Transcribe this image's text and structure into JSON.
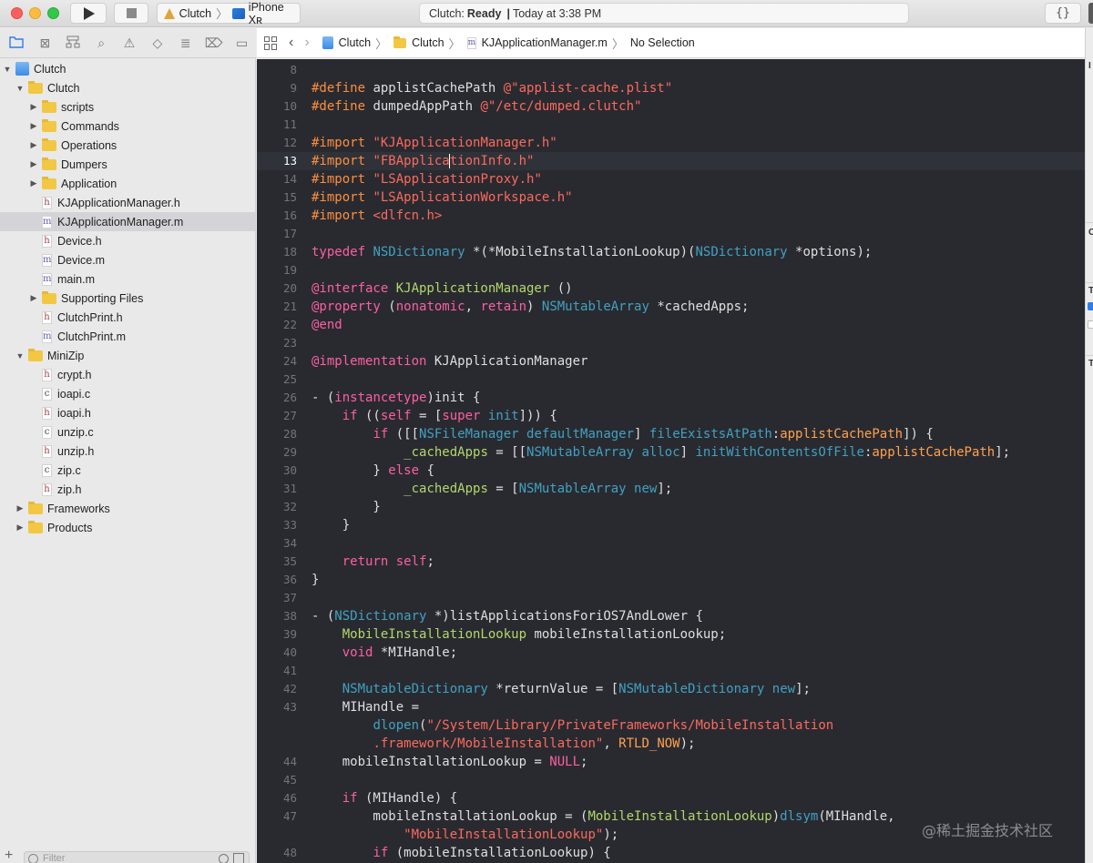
{
  "toolbar": {
    "scheme": {
      "target": "Clutch",
      "device": "iPhone Xʀ"
    },
    "activity": {
      "project": "Clutch:",
      "status": "Ready",
      "separator": "|",
      "time": "Today at 3:38 PM"
    },
    "braces_label": "{}"
  },
  "navigator_tabs": [
    {
      "name": "project-navigator",
      "glyph": "folder",
      "active": true
    },
    {
      "name": "source-control-navigator",
      "glyph": "⊠"
    },
    {
      "name": "symbol-navigator",
      "glyph": "hierarchy"
    },
    {
      "name": "find-navigator",
      "glyph": "⌕"
    },
    {
      "name": "issue-navigator",
      "glyph": "⚠"
    },
    {
      "name": "test-navigator",
      "glyph": "◇"
    },
    {
      "name": "debug-navigator",
      "glyph": "≣"
    },
    {
      "name": "breakpoint-navigator",
      "glyph": "⌦"
    },
    {
      "name": "report-navigator",
      "glyph": "▭"
    }
  ],
  "tree": [
    {
      "label": "Clutch",
      "depth": 0,
      "kind": "project",
      "disclosure": "open"
    },
    {
      "label": "Clutch",
      "depth": 1,
      "kind": "folder",
      "disclosure": "open"
    },
    {
      "label": "scripts",
      "depth": 2,
      "kind": "folder",
      "disclosure": "closed"
    },
    {
      "label": "Commands",
      "depth": 2,
      "kind": "folder",
      "disclosure": "closed"
    },
    {
      "label": "Operations",
      "depth": 2,
      "kind": "folder",
      "disclosure": "closed"
    },
    {
      "label": "Dumpers",
      "depth": 2,
      "kind": "folder",
      "disclosure": "closed"
    },
    {
      "label": "Application",
      "depth": 2,
      "kind": "folder",
      "disclosure": "closed"
    },
    {
      "label": "KJApplicationManager.h",
      "depth": 3,
      "kind": "h"
    },
    {
      "label": "KJApplicationManager.m",
      "depth": 3,
      "kind": "m",
      "selected": true
    },
    {
      "label": "Device.h",
      "depth": 3,
      "kind": "h"
    },
    {
      "label": "Device.m",
      "depth": 3,
      "kind": "m"
    },
    {
      "label": "main.m",
      "depth": 3,
      "kind": "m"
    },
    {
      "label": "Supporting Files",
      "depth": 2,
      "kind": "folder",
      "disclosure": "closed"
    },
    {
      "label": "ClutchPrint.h",
      "depth": 3,
      "kind": "h"
    },
    {
      "label": "ClutchPrint.m",
      "depth": 3,
      "kind": "m"
    },
    {
      "label": "MiniZip",
      "depth": 1,
      "kind": "folder",
      "disclosure": "open"
    },
    {
      "label": "crypt.h",
      "depth": 3,
      "kind": "h"
    },
    {
      "label": "ioapi.c",
      "depth": 3,
      "kind": "c"
    },
    {
      "label": "ioapi.h",
      "depth": 3,
      "kind": "h"
    },
    {
      "label": "unzip.c",
      "depth": 3,
      "kind": "c"
    },
    {
      "label": "unzip.h",
      "depth": 3,
      "kind": "h"
    },
    {
      "label": "zip.c",
      "depth": 3,
      "kind": "c"
    },
    {
      "label": "zip.h",
      "depth": 3,
      "kind": "h"
    },
    {
      "label": "Frameworks",
      "depth": 1,
      "kind": "folder",
      "disclosure": "closed"
    },
    {
      "label": "Products",
      "depth": 1,
      "kind": "folder",
      "disclosure": "closed"
    }
  ],
  "filter": {
    "placeholder": "Filter",
    "add_label": "+"
  },
  "jumpbar": {
    "items": [
      {
        "label": "Clutch",
        "kind": "project"
      },
      {
        "label": "Clutch",
        "kind": "folder"
      },
      {
        "label": "KJApplicationManager.m",
        "kind": "m"
      },
      {
        "label": "No Selection",
        "kind": "none"
      }
    ],
    "separator": "〉"
  },
  "editor": {
    "current_line": 13,
    "lines": [
      {
        "n": "8",
        "tokens": []
      },
      {
        "n": "9",
        "tokens": [
          [
            "k-pre",
            "#define "
          ],
          [
            "k-plain",
            "applistCachePath "
          ],
          [
            "k-str",
            "@\"applist-cache.plist\""
          ]
        ]
      },
      {
        "n": "10",
        "tokens": [
          [
            "k-pre",
            "#define "
          ],
          [
            "k-plain",
            "dumpedAppPath "
          ],
          [
            "k-str",
            "@\"/etc/dumped.clutch\""
          ]
        ]
      },
      {
        "n": "11",
        "tokens": []
      },
      {
        "n": "12",
        "tokens": [
          [
            "k-pre",
            "#import "
          ],
          [
            "k-str",
            "\"KJApplicationManager.h\""
          ]
        ]
      },
      {
        "n": "13",
        "tokens": [
          [
            "k-pre",
            "#import "
          ],
          [
            "k-str",
            "\"FBApplica"
          ],
          [
            "caret",
            ""
          ],
          [
            "k-str",
            "tionInfo.h\""
          ]
        ]
      },
      {
        "n": "14",
        "tokens": [
          [
            "k-pre",
            "#import "
          ],
          [
            "k-str",
            "\"LSApplicationProxy.h\""
          ]
        ]
      },
      {
        "n": "15",
        "tokens": [
          [
            "k-pre",
            "#import "
          ],
          [
            "k-str",
            "\"LSApplicationWorkspace.h\""
          ]
        ]
      },
      {
        "n": "16",
        "tokens": [
          [
            "k-pre",
            "#import "
          ],
          [
            "k-str",
            "<dlfcn.h>"
          ]
        ]
      },
      {
        "n": "17",
        "tokens": []
      },
      {
        "n": "18",
        "tokens": [
          [
            "k-kw",
            "typedef "
          ],
          [
            "k-sys",
            "NSDictionary"
          ],
          [
            "k-plain",
            " *(*MobileInstallationLookup)("
          ],
          [
            "k-sys",
            "NSDictionary"
          ],
          [
            "k-plain",
            " *options);"
          ]
        ]
      },
      {
        "n": "19",
        "tokens": []
      },
      {
        "n": "20",
        "tokens": [
          [
            "k-kw",
            "@interface "
          ],
          [
            "k-decl",
            "KJApplicationManager"
          ],
          [
            "k-plain",
            " ()"
          ]
        ]
      },
      {
        "n": "21",
        "tokens": [
          [
            "k-kw",
            "@property "
          ],
          [
            "k-plain",
            "("
          ],
          [
            "k-kw",
            "nonatomic"
          ],
          [
            "k-plain",
            ", "
          ],
          [
            "k-kw",
            "retain"
          ],
          [
            "k-plain",
            ") "
          ],
          [
            "k-sys",
            "NSMutableArray"
          ],
          [
            "k-plain",
            " *cachedApps;"
          ]
        ]
      },
      {
        "n": "22",
        "tokens": [
          [
            "k-kw",
            "@end"
          ]
        ]
      },
      {
        "n": "23",
        "tokens": []
      },
      {
        "n": "24",
        "tokens": [
          [
            "k-kw",
            "@implementation "
          ],
          [
            "k-plain",
            "KJApplicationManager"
          ]
        ]
      },
      {
        "n": "25",
        "tokens": []
      },
      {
        "n": "26",
        "tokens": [
          [
            "k-plain",
            "- ("
          ],
          [
            "k-kw",
            "instancetype"
          ],
          [
            "k-plain",
            ")init {"
          ]
        ]
      },
      {
        "n": "27",
        "tokens": [
          [
            "k-plain",
            "    "
          ],
          [
            "k-kw",
            "if"
          ],
          [
            "k-plain",
            " (("
          ],
          [
            "k-kw",
            "self"
          ],
          [
            "k-plain",
            " = ["
          ],
          [
            "k-kw",
            "super"
          ],
          [
            "k-plain",
            " "
          ],
          [
            "k-sys",
            "init"
          ],
          [
            "k-plain",
            "])) {"
          ]
        ]
      },
      {
        "n": "28",
        "tokens": [
          [
            "k-plain",
            "        "
          ],
          [
            "k-kw",
            "if"
          ],
          [
            "k-plain",
            " ([["
          ],
          [
            "k-sys",
            "NSFileManager"
          ],
          [
            "k-plain",
            " "
          ],
          [
            "k-sys",
            "defaultManager"
          ],
          [
            "k-plain",
            "] "
          ],
          [
            "k-sys",
            "fileExistsAtPath"
          ],
          [
            "k-plain",
            ":"
          ],
          [
            "k-var",
            "applistCachePath"
          ],
          [
            "k-plain",
            "]) {"
          ]
        ]
      },
      {
        "n": "29",
        "tokens": [
          [
            "k-plain",
            "            "
          ],
          [
            "k-decl",
            "_cachedApps"
          ],
          [
            "k-plain",
            " = [["
          ],
          [
            "k-sys",
            "NSMutableArray"
          ],
          [
            "k-plain",
            " "
          ],
          [
            "k-sys",
            "alloc"
          ],
          [
            "k-plain",
            "] "
          ],
          [
            "k-sys",
            "initWithContentsOfFile"
          ],
          [
            "k-plain",
            ":"
          ],
          [
            "k-var",
            "applistCachePath"
          ],
          [
            "k-plain",
            "];"
          ]
        ]
      },
      {
        "n": "30",
        "tokens": [
          [
            "k-plain",
            "        } "
          ],
          [
            "k-kw",
            "else"
          ],
          [
            "k-plain",
            " {"
          ]
        ]
      },
      {
        "n": "31",
        "tokens": [
          [
            "k-plain",
            "            "
          ],
          [
            "k-decl",
            "_cachedApps"
          ],
          [
            "k-plain",
            " = ["
          ],
          [
            "k-sys",
            "NSMutableArray"
          ],
          [
            "k-plain",
            " "
          ],
          [
            "k-sys",
            "new"
          ],
          [
            "k-plain",
            "];"
          ]
        ]
      },
      {
        "n": "32",
        "tokens": [
          [
            "k-plain",
            "        }"
          ]
        ]
      },
      {
        "n": "33",
        "tokens": [
          [
            "k-plain",
            "    }"
          ]
        ]
      },
      {
        "n": "34",
        "tokens": []
      },
      {
        "n": "35",
        "tokens": [
          [
            "k-plain",
            "    "
          ],
          [
            "k-kw",
            "return"
          ],
          [
            "k-plain",
            " "
          ],
          [
            "k-kw",
            "self"
          ],
          [
            "k-plain",
            ";"
          ]
        ]
      },
      {
        "n": "36",
        "tokens": [
          [
            "k-plain",
            "}"
          ]
        ]
      },
      {
        "n": "37",
        "tokens": []
      },
      {
        "n": "38",
        "tokens": [
          [
            "k-plain",
            "- ("
          ],
          [
            "k-sys",
            "NSDictionary"
          ],
          [
            "k-plain",
            " *)listApplicationsForiOS7AndLower {"
          ]
        ]
      },
      {
        "n": "39",
        "tokens": [
          [
            "k-plain",
            "    "
          ],
          [
            "k-decl",
            "MobileInstallationLookup"
          ],
          [
            "k-plain",
            " mobileInstallationLookup;"
          ]
        ]
      },
      {
        "n": "40",
        "tokens": [
          [
            "k-plain",
            "    "
          ],
          [
            "k-kw",
            "void"
          ],
          [
            "k-plain",
            " *MIHandle;"
          ]
        ]
      },
      {
        "n": "41",
        "tokens": []
      },
      {
        "n": "42",
        "tokens": [
          [
            "k-plain",
            "    "
          ],
          [
            "k-sys",
            "NSMutableDictionary"
          ],
          [
            "k-plain",
            " *returnValue = ["
          ],
          [
            "k-sys",
            "NSMutableDictionary"
          ],
          [
            "k-plain",
            " "
          ],
          [
            "k-sys",
            "new"
          ],
          [
            "k-plain",
            "];"
          ]
        ]
      },
      {
        "n": "43",
        "tokens": [
          [
            "k-plain",
            "    MIHandle ="
          ]
        ]
      },
      {
        "n": "",
        "tokens": [
          [
            "k-plain",
            "        "
          ],
          [
            "k-sys",
            "dlopen"
          ],
          [
            "k-plain",
            "("
          ],
          [
            "k-str",
            "\"/System/Library/PrivateFrameworks/MobileInstallation"
          ]
        ]
      },
      {
        "n": "",
        "tokens": [
          [
            "k-plain",
            "        "
          ],
          [
            "k-str",
            ".framework/MobileInstallation\""
          ],
          [
            "k-plain",
            ", "
          ],
          [
            "k-var",
            "RTLD_NOW"
          ],
          [
            "k-plain",
            ");"
          ]
        ]
      },
      {
        "n": "44",
        "tokens": [
          [
            "k-plain",
            "    mobileInstallationLookup = "
          ],
          [
            "k-kw",
            "NULL"
          ],
          [
            "k-plain",
            ";"
          ]
        ]
      },
      {
        "n": "45",
        "tokens": []
      },
      {
        "n": "46",
        "tokens": [
          [
            "k-plain",
            "    "
          ],
          [
            "k-kw",
            "if"
          ],
          [
            "k-plain",
            " (MIHandle) {"
          ]
        ]
      },
      {
        "n": "47",
        "tokens": [
          [
            "k-plain",
            "        mobileInstallationLookup = ("
          ],
          [
            "k-decl",
            "MobileInstallationLookup"
          ],
          [
            "k-plain",
            ")"
          ],
          [
            "k-sys",
            "dlsym"
          ],
          [
            "k-plain",
            "(MIHandle,"
          ]
        ]
      },
      {
        "n": "",
        "tokens": [
          [
            "k-plain",
            "            "
          ],
          [
            "k-str",
            "\"MobileInstallationLookup\""
          ],
          [
            "k-plain",
            ");"
          ]
        ]
      },
      {
        "n": "48",
        "tokens": [
          [
            "k-plain",
            "        "
          ],
          [
            "k-kw",
            "if"
          ],
          [
            "k-plain",
            " (mobileInstallationLookup) {"
          ]
        ]
      }
    ]
  },
  "inspector": {
    "labels": [
      "I",
      "C",
      "T",
      "T"
    ]
  },
  "watermark": "@稀土掘金技术社区"
}
